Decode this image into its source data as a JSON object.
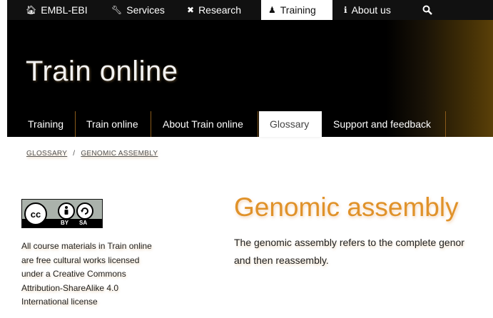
{
  "global_nav": {
    "items": [
      {
        "label": "EMBL-EBI",
        "icon": "home-icon"
      },
      {
        "label": "Services",
        "icon": "wrench-icon"
      },
      {
        "label": "Research",
        "icon": "research-icon"
      },
      {
        "label": "Training",
        "icon": "training-icon",
        "active": true
      },
      {
        "label": "About us",
        "icon": "info-icon"
      }
    ],
    "search_icon": "search-icon"
  },
  "masthead": {
    "title": "Train online"
  },
  "local_nav": {
    "items": [
      {
        "label": "Training"
      },
      {
        "label": "Train online"
      },
      {
        "label": "About Train online"
      },
      {
        "label": "Glossary",
        "active": true
      },
      {
        "label": "Support and feedback"
      }
    ]
  },
  "breadcrumb": {
    "items": [
      "GLOSSARY",
      "GENOMIC ASSEMBLY"
    ],
    "separator": "/"
  },
  "license": {
    "badge_text": [
      "cc",
      "BY",
      "SA"
    ],
    "lines": [
      "All course materials in Train online",
      "are free cultural works licensed",
      "under a Creative Commons",
      "Attribution-ShareAlike 4.0",
      "International license"
    ]
  },
  "content": {
    "title": "Genomic assembly",
    "lines": [
      "The genomic assembly refers to the complete genor",
      "and then reassembly."
    ]
  },
  "colors": {
    "accent": "#e0922a",
    "nav_bg": "#111111",
    "masthead_bg": "#000000"
  }
}
